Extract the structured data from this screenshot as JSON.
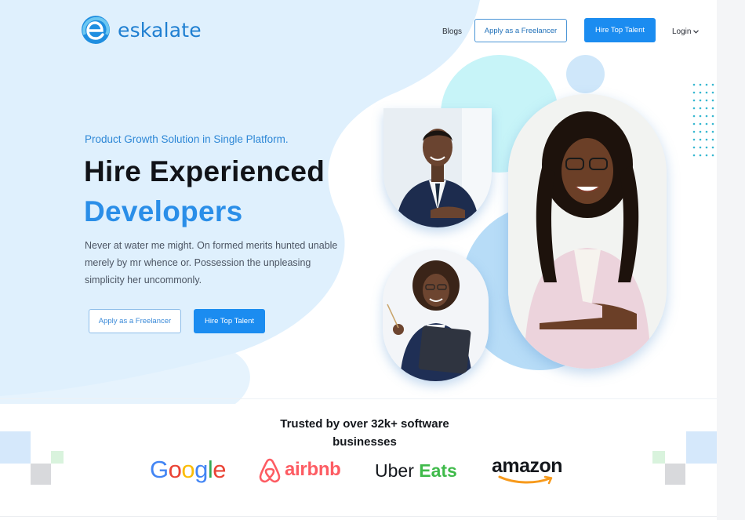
{
  "brand": {
    "name": "eskalate",
    "color": "#1f7fd1"
  },
  "nav": {
    "blogs": "Blogs",
    "apply": "Apply as a Freelancer",
    "hire": "Hire Top Talent",
    "login": "Login"
  },
  "hero": {
    "tagline": "Product Growth Solution in Single Platform.",
    "headline_line1": "Hire Experienced",
    "headline_line2": "Developers",
    "description": "Never at water me might. On formed merits hunted unable merely by mr whence or. Possession the unpleasing simplicity her uncommonly.",
    "apply_button": "Apply as a Freelancer",
    "hire_button": "Hire Top Talent"
  },
  "trusted": {
    "heading": "Trusted by over 32k+ software businesses",
    "logos": {
      "google": "Google",
      "airbnb": "airbnb",
      "uber": "Uber",
      "eats": "Eats",
      "amazon": "amazon"
    }
  },
  "colors": {
    "accent": "#1b8cf0",
    "hero_blob": "#dff0fd",
    "headline_blue": "#2a8ee8"
  },
  "icons": [
    "logo-mark-icon",
    "chevron-down-icon",
    "airbnb-icon",
    "amazon-smile-icon"
  ]
}
